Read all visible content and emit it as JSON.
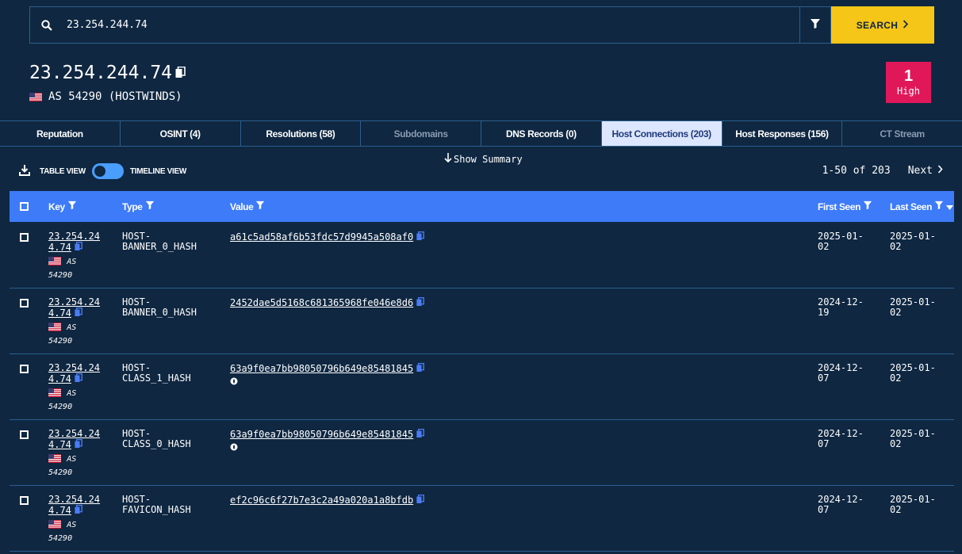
{
  "search": {
    "value": "23.254.244.74",
    "button_label": "SEARCH"
  },
  "header": {
    "ip": "23.254.244.74",
    "asn": "AS 54290 (HOSTWINDS)"
  },
  "risk": {
    "count": "1",
    "label": "High",
    "color": "#e0185a"
  },
  "tabs": [
    {
      "label": "Reputation",
      "state": "normal"
    },
    {
      "label": "OSINT (4)",
      "state": "normal"
    },
    {
      "label": "Resolutions (58)",
      "state": "normal"
    },
    {
      "label": "Subdomains",
      "state": "disabled"
    },
    {
      "label": "DNS Records (0)",
      "state": "normal"
    },
    {
      "label": "Host Connections (203)",
      "state": "active"
    },
    {
      "label": "Host Responses (156)",
      "state": "normal"
    },
    {
      "label": "CT Stream",
      "state": "disabled"
    }
  ],
  "controls": {
    "show_summary": "Show Summary",
    "table_view": "TABLE VIEW",
    "timeline_view": "TIMELINE VIEW",
    "pagination": "1-50 of 203",
    "next": "Next"
  },
  "table": {
    "columns": {
      "key": "Key",
      "type": "Type",
      "value": "Value",
      "first_seen": "First Seen",
      "last_seen": "Last Seen"
    },
    "rows": [
      {
        "key_line1": "23.254.24",
        "key_line2": "4.74",
        "as": "AS",
        "asn": "54290",
        "type_line1": "HOST-",
        "type_line2": "BANNER_0_HASH",
        "value": "a61c5ad58af6b53fdc57d9945a508af0",
        "fire": false,
        "first_line1": "2025-01-",
        "first_line2": "02",
        "last_line1": "2025-01-",
        "last_line2": "02"
      },
      {
        "key_line1": "23.254.24",
        "key_line2": "4.74",
        "as": "AS",
        "asn": "54290",
        "type_line1": "HOST-",
        "type_line2": "BANNER_0_HASH",
        "value": "2452dae5d5168c681365968fe046e8d6",
        "fire": false,
        "first_line1": "2024-12-",
        "first_line2": "19",
        "last_line1": "2025-01-",
        "last_line2": "02"
      },
      {
        "key_line1": "23.254.24",
        "key_line2": "4.74",
        "as": "AS",
        "asn": "54290",
        "type_line1": "HOST-",
        "type_line2": "CLASS_1_HASH",
        "value": "63a9f0ea7bb98050796b649e85481845",
        "fire": true,
        "first_line1": "2024-12-",
        "first_line2": "07",
        "last_line1": "2025-01-",
        "last_line2": "02"
      },
      {
        "key_line1": "23.254.24",
        "key_line2": "4.74",
        "as": "AS",
        "asn": "54290",
        "type_line1": "HOST-",
        "type_line2": "CLASS_0_HASH",
        "value": "63a9f0ea7bb98050796b649e85481845",
        "fire": true,
        "first_line1": "2024-12-",
        "first_line2": "07",
        "last_line1": "2025-01-",
        "last_line2": "02"
      },
      {
        "key_line1": "23.254.24",
        "key_line2": "4.74",
        "as": "AS",
        "asn": "54290",
        "type_line1": "HOST-",
        "type_line2": "FAVICON_HASH",
        "value": "ef2c96c6f27b7e3c2a49a020a1a8bfdb",
        "fire": false,
        "first_line1": "2024-12-",
        "first_line2": "07",
        "last_line1": "2025-01-",
        "last_line2": "02"
      }
    ]
  },
  "colors": {
    "background": "#0f2741",
    "accent": "#3d7bf8",
    "search_button": "#f5c518",
    "border": "#2c5f8f",
    "active_tab": "#dde6ff"
  }
}
